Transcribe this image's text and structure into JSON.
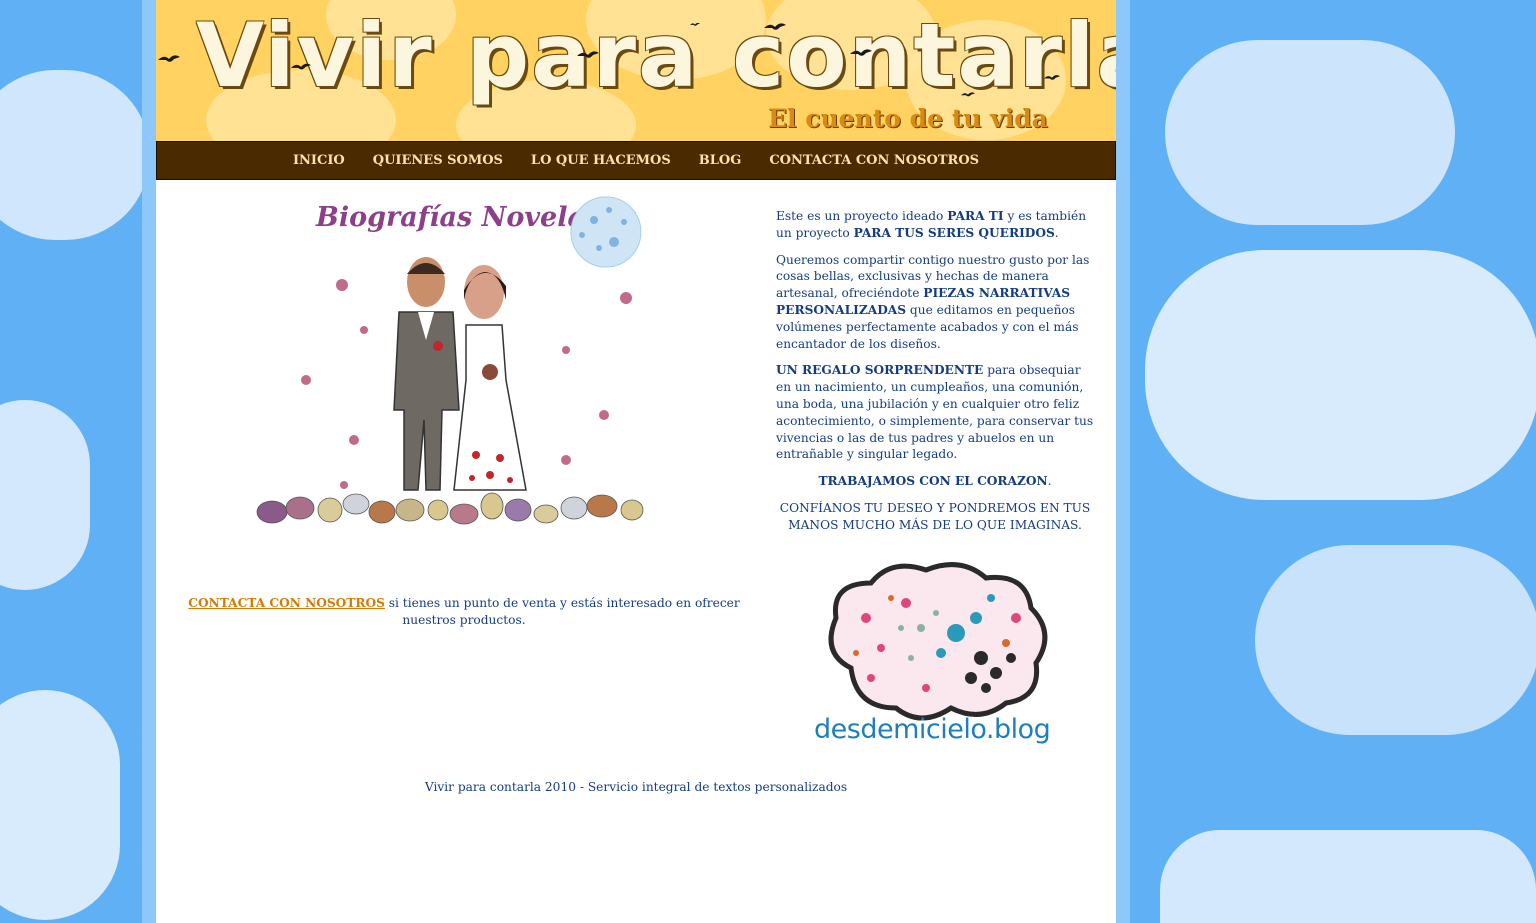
{
  "header": {
    "title": "Vivir para contarla",
    "subtitle": "El cuento de tu vida"
  },
  "nav": {
    "items": [
      "INICIO",
      "QUIENES SOMOS",
      "LO QUE HACEMOS",
      "BLOG",
      "CONTACTA CON NOSOTROS"
    ]
  },
  "illustration": {
    "title": "Biografías Noveladas"
  },
  "intro": {
    "p1_a": "Este es un proyecto ideado ",
    "p1_b": "PARA TI",
    "p1_c": " y es también un proyecto ",
    "p1_d": "PARA TUS SERES QUERIDOS",
    "p1_e": ".",
    "p2_a": "Queremos compartir contigo nuestro gusto por las cosas bellas, exclusivas y hechas de manera artesanal, ofreciéndote ",
    "p2_b": "PIEZAS NARRATIVAS PERSONALIZADAS",
    "p2_c": " que editamos en pequeños volúmenes perfectamente acabados y con el más encantador de los diseños.",
    "p3_a": "UN REGALO SORPRENDENTE",
    "p3_b": " para obsequiar en un nacimiento, un cumpleaños, una comunión, una boda, una jubilación y en cualquier otro feliz acontecimiento, o simplemente, para conservar tus vivencias o las de tus padres y abuelos en un entrañable y singular legado.",
    "p4_a": "TRABAJAMOS CON EL CORAZON",
    "p4_b": ".",
    "p5": "CONFÍANOS TU DESEO Y PONDREMOS EN TUS MANOS MUCHO MÁS DE LO QUE IMAGINAS."
  },
  "contact": {
    "link": "CONTACTA CON NOSOTROS",
    "text": " si tienes un punto de venta y estás interesado en ofrecer nuestros productos."
  },
  "blog": {
    "name": "desdemicielo.blog"
  },
  "footer": {
    "text": "Vivir para contarla 2010 - Servicio integral de textos personalizados"
  },
  "colors": {
    "sky": "#5fb0f5",
    "banner": "#ffd261",
    "nav": "#4a2a00",
    "text": "#143c84",
    "link": "#d97a00",
    "blog": "#1f7fbd"
  }
}
